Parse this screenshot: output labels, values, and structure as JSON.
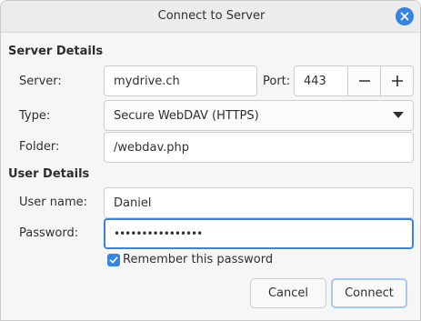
{
  "window": {
    "title": "Connect to Server",
    "close_icon": "close-icon"
  },
  "server_details": {
    "heading": "Server Details",
    "server_label": "Server:",
    "server_value": "mydrive.ch",
    "port_label": "Port:",
    "port_value": "443",
    "decrement_symbol": "−",
    "increment_symbol": "+",
    "type_label": "Type:",
    "type_value": "Secure WebDAV (HTTPS)",
    "folder_label": "Folder:",
    "folder_value": "/webdav.php"
  },
  "user_details": {
    "heading": "User Details",
    "username_label": "User name:",
    "username_value": "Daniel",
    "password_label": "Password:",
    "password_value": "••••••••••••••••",
    "remember_label": "Remember this password",
    "remember_checked": true
  },
  "buttons": {
    "cancel": "Cancel",
    "connect": "Connect"
  },
  "colors": {
    "accent": "#3584e4",
    "titlebar": "#ececec",
    "background": "#f6f6f6"
  }
}
